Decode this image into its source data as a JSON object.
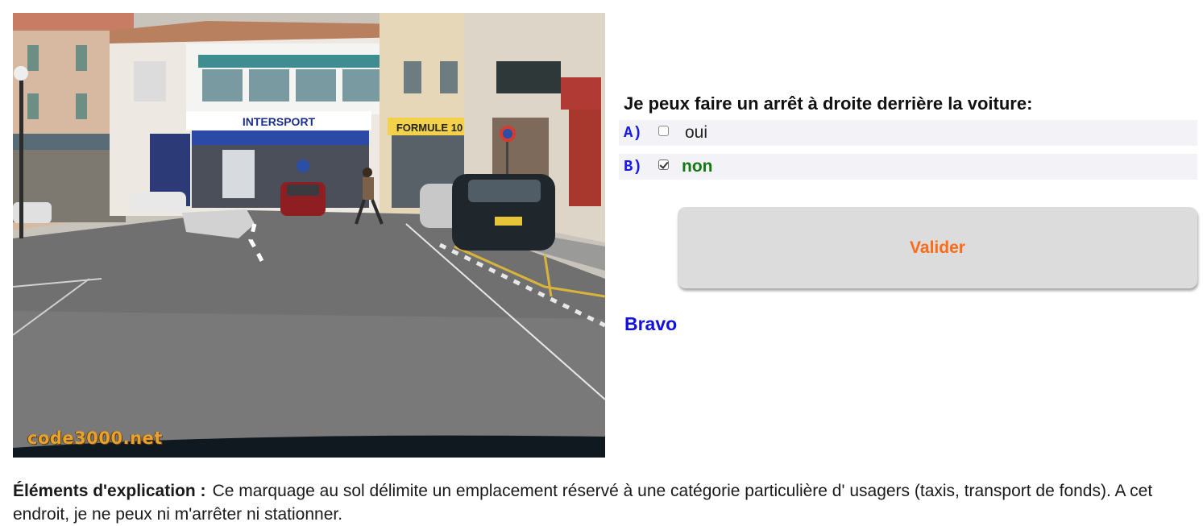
{
  "photo": {
    "watermark": "code3000.net",
    "signs": [
      "INTERSPORT",
      "FORMULE 10"
    ]
  },
  "quiz": {
    "question": "Je peux faire un arrêt à droite derrière la voiture:",
    "answers": [
      {
        "letter": "A)",
        "text": "oui",
        "checked": false
      },
      {
        "letter": "B)",
        "text": "non",
        "checked": true
      }
    ],
    "validate_label": "Valider",
    "feedback": "Bravo"
  },
  "explanation": {
    "label": "Éléments d'explication :",
    "text": "Ce marquage au sol délimite un emplacement réservé à une catégorie particulière d' usagers (taxis, transport de fonds). A cet endroit, je ne peux ni m'arrêter ni stationner."
  },
  "colors": {
    "answer_letter": "#1a1aee",
    "correct_answer": "#137a13",
    "validate_text": "#ff6a16",
    "feedback": "#1010e0"
  }
}
